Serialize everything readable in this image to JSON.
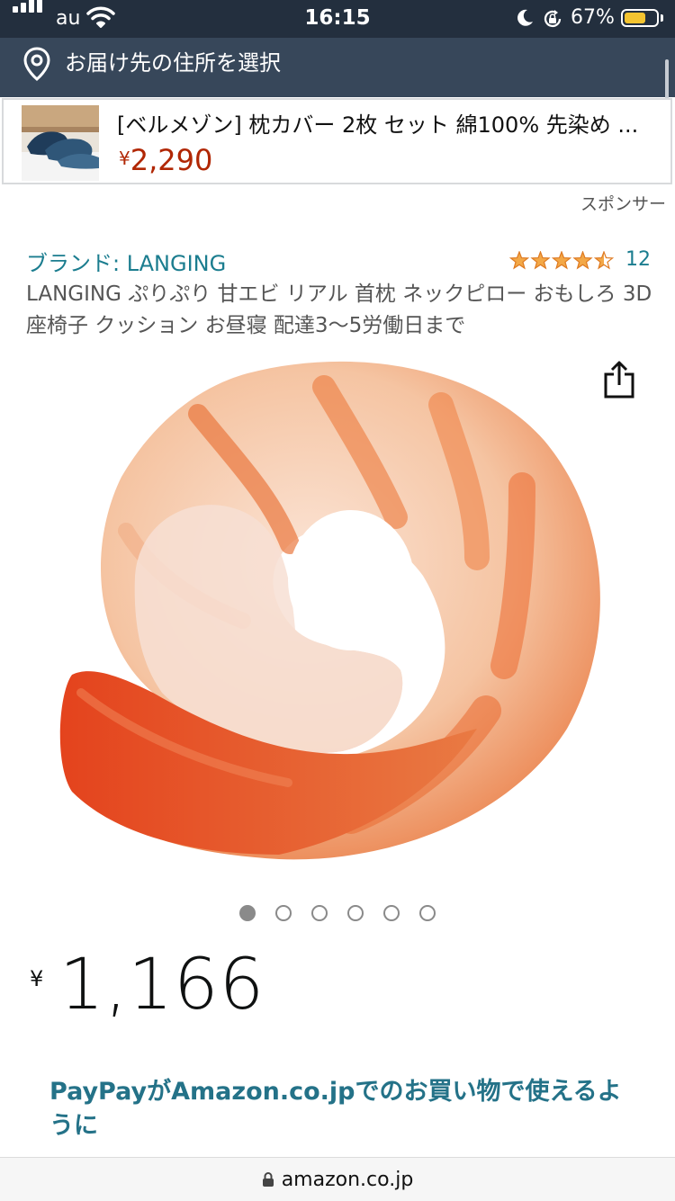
{
  "status_bar": {
    "carrier": "au",
    "time": "16:15",
    "battery_percent": "67%",
    "battery_level": 0.67,
    "icons": [
      "signal-icon",
      "wifi-icon",
      "moon-icon",
      "rotation-lock-icon",
      "battery-icon"
    ]
  },
  "delivery": {
    "text": "お届け先の住所を選択",
    "icon": "location-pin-icon"
  },
  "sponsored": {
    "title": "[ベルメゾン] 枕カバー 2枚 セット 綿100% 先染め ...",
    "currency": "¥",
    "price": "2,290",
    "label": "スポンサー"
  },
  "product": {
    "brand": "ブランド: LANGING",
    "rating": 4.5,
    "review_count": "12",
    "title": "LANGING ぷりぷり 甘エビ リアル 首枕 ネックピロー おもしろ 3D 座椅子 クッション お昼寝 配達3〜5労働日まで",
    "image_icon": "shrimp-neck-pillow-image",
    "carousel": {
      "count": 6,
      "active": 0
    },
    "currency": "¥",
    "price": "1,166"
  },
  "promo": {
    "text": "PayPayがAmazon.co.jpでのお買い物で使えるように"
  },
  "browser": {
    "url": "amazon.co.jp"
  },
  "colors": {
    "header_dark": "#232f3e",
    "address_bar": "#37475a",
    "price_red": "#b12704",
    "link_teal": "#1b7d8f",
    "promo_teal": "#247288",
    "star": "#f3a847"
  }
}
